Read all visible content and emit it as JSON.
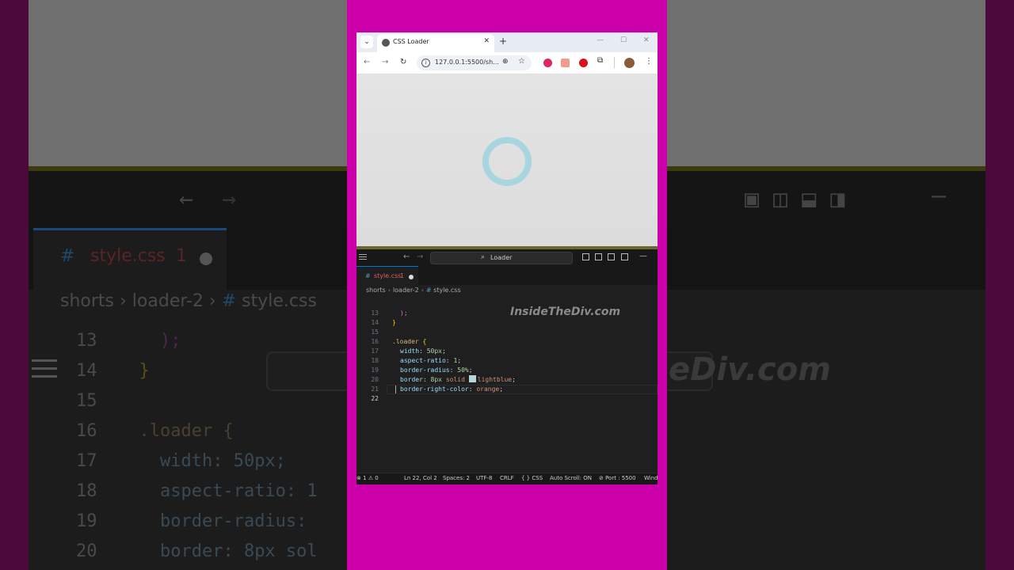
{
  "background": {
    "tab_hash": "#",
    "tab_file": "style.css",
    "tab_count": "1",
    "breadcrumb": [
      "shorts",
      "loader-2",
      "style.css"
    ],
    "lines": [
      {
        "num": "13",
        "text": ");"
      },
      {
        "num": "14",
        "text": "}"
      },
      {
        "num": "15",
        "text": ""
      },
      {
        "num": "16",
        "text": ".loader {"
      },
      {
        "num": "17",
        "text": "width: 50px;"
      },
      {
        "num": "18",
        "text": "aspect-ratio: 1"
      },
      {
        "num": "19",
        "text": "border-radius:"
      },
      {
        "num": "20",
        "text": "border: 8px sol"
      }
    ],
    "watermark": "eDiv.com"
  },
  "browser": {
    "tab_title": "CSS Loader",
    "url": "127.0.0.1:5500/sh...",
    "loader": {
      "color": "#add8e6",
      "size": "50px",
      "border": "8px solid lightblue"
    }
  },
  "editor": {
    "search_text": "Loader",
    "tab": {
      "hash": "#",
      "name": "style.css",
      "problems": "1"
    },
    "breadcrumb": {
      "folder1": "shorts",
      "folder2": "loader-2",
      "hash": "#",
      "file": "style.css"
    },
    "watermark": "InsideTheDiv.com",
    "lines": [
      {
        "num": "13",
        "text": ");"
      },
      {
        "num": "14",
        "text": "}"
      },
      {
        "num": "15",
        "text": ""
      },
      {
        "num": "16",
        "selector": ".loader",
        "brace": "{"
      },
      {
        "num": "17",
        "prop": "width",
        "value": "50px",
        "end": ";"
      },
      {
        "num": "18",
        "prop": "aspect-ratio",
        "value": "1",
        "end": ";"
      },
      {
        "num": "19",
        "prop": "border-radius",
        "value": "50%",
        "end": ";"
      },
      {
        "num": "20",
        "prop": "border",
        "value1": "8px",
        "value2": "solid",
        "value3": "lightblue",
        "end": ";"
      },
      {
        "num": "21",
        "prop": "border-right-color",
        "value": "orange",
        "end": ";"
      },
      {
        "num": "22",
        "text": ""
      }
    ],
    "status": {
      "problems": "⊗ 1 ⚠ 0",
      "position": "Ln 22, Col 2",
      "spaces": "Spaces: 2",
      "encoding": "UTF-8",
      "eol": "CRLF",
      "language": "{ } CSS",
      "autoscroll": "Auto Scroll: ON",
      "port": "⊘ Port : 5500",
      "extra": "Wind"
    }
  },
  "colors": {
    "frame": "#cc00aa",
    "accent": "#0078d4",
    "loader": "#add8e6"
  }
}
